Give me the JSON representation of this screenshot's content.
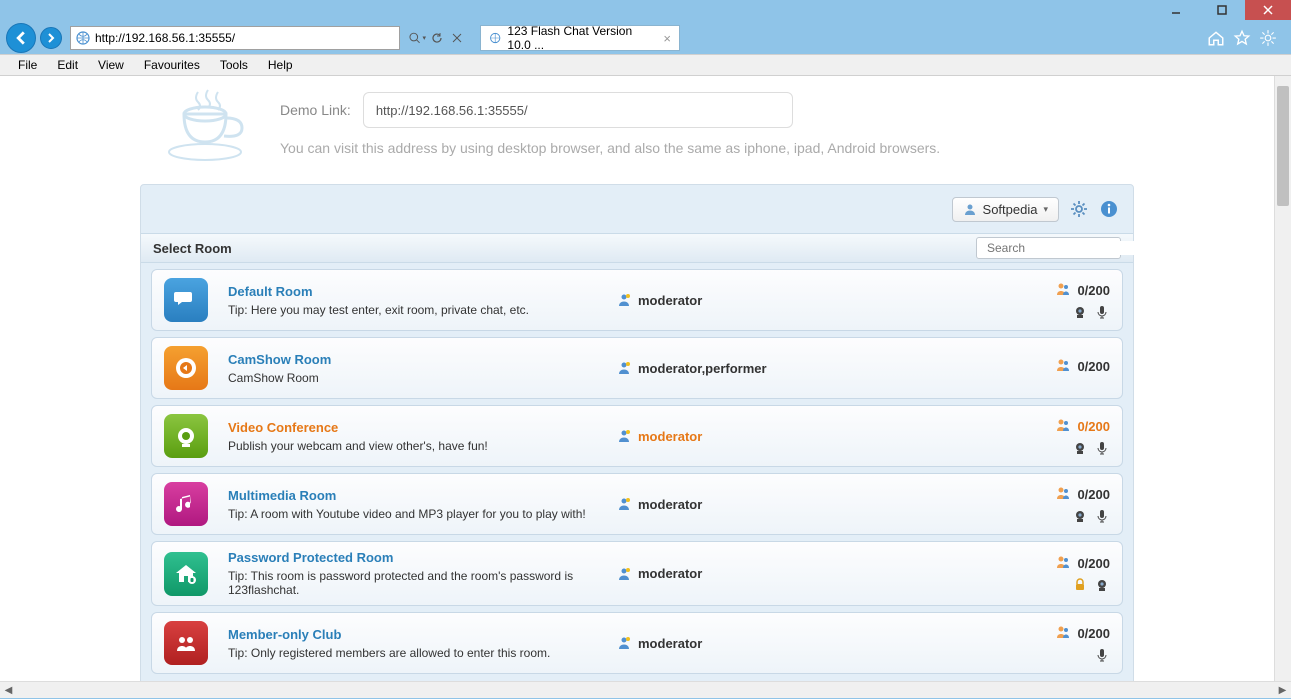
{
  "window": {
    "url": "http://192.168.56.1:35555/",
    "tab_title": "123 Flash Chat Version 10.0 ..."
  },
  "menu": {
    "file": "File",
    "edit": "Edit",
    "view": "View",
    "favourites": "Favourites",
    "tools": "Tools",
    "help": "Help"
  },
  "demo": {
    "label": "Demo Link:",
    "value": "http://192.168.56.1:35555/",
    "desc": "You can visit this address by using desktop browser, and also the same as iphone, ipad, Android browsers."
  },
  "topbar": {
    "user": "Softpedia"
  },
  "select_label": "Select Room",
  "search_placeholder": "Search",
  "rooms": [
    {
      "title": "Default Room",
      "tip": "Tip: Here you may test enter, exit room, private chat, etc.",
      "mod": "moderator",
      "count": "0/200",
      "color": "blue",
      "iconset": "cammic",
      "highlight": false,
      "icon": "chat"
    },
    {
      "title": "CamShow Room",
      "tip": "CamShow Room",
      "mod": "moderator,performer",
      "count": "0/200",
      "color": "orange",
      "iconset": "none",
      "highlight": false,
      "icon": "eye"
    },
    {
      "title": "Video Conference",
      "tip": "Publish your webcam and view other's, have fun!",
      "mod": "moderator",
      "count": "0/200",
      "color": "green",
      "iconset": "cammic",
      "highlight": true,
      "icon": "cam"
    },
    {
      "title": "Multimedia Room",
      "tip": "Tip: A room with Youtube video and MP3 player for you to play with!",
      "mod": "moderator",
      "count": "0/200",
      "color": "magenta",
      "iconset": "cammic",
      "highlight": false,
      "icon": "music"
    },
    {
      "title": "Password Protected Room",
      "tip": "Tip: This room is password protected and the room's password is 123flashchat.",
      "mod": "moderator",
      "count": "0/200",
      "color": "teal",
      "iconset": "lockcam",
      "highlight": false,
      "icon": "house"
    },
    {
      "title": "Member-only Club",
      "tip": "Tip: Only registered members are allowed to enter this room.",
      "mod": "moderator",
      "count": "0/200",
      "color": "red",
      "iconset": "mic",
      "highlight": false,
      "icon": "group"
    }
  ]
}
